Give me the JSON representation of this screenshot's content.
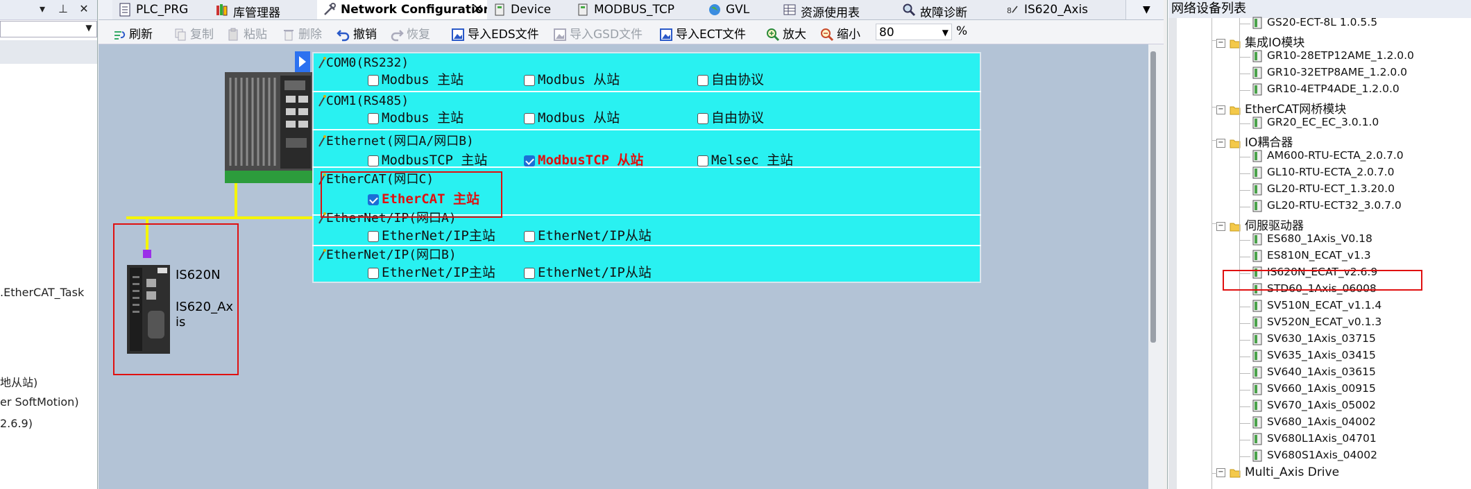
{
  "left_pane": {
    "items": [
      ".EtherCAT_Task",
      "地从站)",
      "er SoftMotion)",
      "2.6.9)"
    ]
  },
  "tabs": [
    {
      "label": "PLC_PRG",
      "icon": "document-icon"
    },
    {
      "label": "库管理器",
      "icon": "library-icon"
    },
    {
      "label": "Network Configuration",
      "icon": "network-config-icon",
      "active": true
    },
    {
      "label": "Device",
      "icon": "device-icon"
    },
    {
      "label": "MODBUS_TCP",
      "icon": "device-icon"
    },
    {
      "label": "GVL",
      "icon": "globe-icon"
    },
    {
      "label": "资源使用表",
      "icon": "table-icon"
    },
    {
      "label": "故障诊断",
      "icon": "magnifier-icon"
    },
    {
      "label": "IS620_Axis",
      "icon": "axis-icon"
    }
  ],
  "toolbar": {
    "refresh": "刷新",
    "copy": "复制",
    "paste": "粘贴",
    "delete": "删除",
    "undo": "撤销",
    "redo": "恢复",
    "import_eds": "导入EDS文件",
    "import_gsd": "导入GSD文件",
    "import_ect": "导入ECT文件",
    "zoom_in": "放大",
    "zoom_out": "缩小",
    "zoom_value": "80",
    "zoom_unit": "%"
  },
  "protocols": [
    {
      "port": "COM0(RS232)",
      "options": [
        {
          "label": "Modbus 主站",
          "checked": false
        },
        {
          "label": "Modbus 从站",
          "checked": false
        },
        {
          "label": "自由协议",
          "checked": false
        }
      ]
    },
    {
      "port": "COM1(RS485)",
      "options": [
        {
          "label": "Modbus 主站",
          "checked": false
        },
        {
          "label": "Modbus 从站",
          "checked": false
        },
        {
          "label": "自由协议",
          "checked": false
        }
      ]
    },
    {
      "port": "Ethernet(网口A/网口B)",
      "options": [
        {
          "label": "ModbusTCP 主站",
          "checked": false
        },
        {
          "label": "ModbusTCP 从站",
          "checked": true
        },
        {
          "label": "Melsec 主站",
          "checked": false
        }
      ]
    },
    {
      "port": "EtherCAT(网口C)",
      "options": [
        {
          "label": "EtherCAT 主站",
          "checked": true
        }
      ]
    },
    {
      "port": "EtherNet/IP(网口A)",
      "options": [
        {
          "label": "EtherNet/IP主站",
          "checked": false
        },
        {
          "label": "EtherNet/IP从站",
          "checked": false
        }
      ]
    },
    {
      "port": "EtherNet/IP(网口B)",
      "options": [
        {
          "label": "EtherNet/IP主站",
          "checked": false
        },
        {
          "label": "EtherNet/IP从站",
          "checked": false
        }
      ]
    }
  ],
  "slave_device": {
    "model": "IS620N",
    "name": "IS620_Axis"
  },
  "device_list": {
    "title": "网络设备列表",
    "tree": [
      {
        "label": "GS20-ECT-8L 1.0.5.5",
        "type": "device"
      },
      {
        "label": "集成IO模块",
        "type": "folder"
      },
      {
        "label": "GR10-28ETP12AME_1.2.0.0",
        "type": "device"
      },
      {
        "label": "GR10-32ETP8AME_1.2.0.0",
        "type": "device"
      },
      {
        "label": "GR10-4ETP4ADE_1.2.0.0",
        "type": "device"
      },
      {
        "label": "EtherCAT网桥模块",
        "type": "folder"
      },
      {
        "label": "GR20_EC_EC_3.0.1.0",
        "type": "device"
      },
      {
        "label": "IO耦合器",
        "type": "folder"
      },
      {
        "label": "AM600-RTU-ECTA_2.0.7.0",
        "type": "device"
      },
      {
        "label": "GL10-RTU-ECTA_2.0.7.0",
        "type": "device"
      },
      {
        "label": "GL20-RTU-ECT_1.3.20.0",
        "type": "device"
      },
      {
        "label": "GL20-RTU-ECT32_3.0.7.0",
        "type": "device"
      },
      {
        "label": "伺服驱动器",
        "type": "folder"
      },
      {
        "label": "ES680_1Axis_V0.18",
        "type": "device"
      },
      {
        "label": "ES810N_ECAT_v1.3",
        "type": "device"
      },
      {
        "label": "IS620N_ECAT_v2.6.9",
        "type": "device"
      },
      {
        "label": "STD60_1Axis_06008",
        "type": "device"
      },
      {
        "label": "SV510N_ECAT_v1.1.4",
        "type": "device"
      },
      {
        "label": "SV520N_ECAT_v0.1.3",
        "type": "device"
      },
      {
        "label": "SV630_1Axis_03715",
        "type": "device"
      },
      {
        "label": "SV635_1Axis_03415",
        "type": "device"
      },
      {
        "label": "SV640_1Axis_03615",
        "type": "device"
      },
      {
        "label": "SV660_1Axis_00915",
        "type": "device"
      },
      {
        "label": "SV670_1Axis_05002",
        "type": "device"
      },
      {
        "label": "SV680_1Axis_04002",
        "type": "device"
      },
      {
        "label": "SV680L1Axis_04701",
        "type": "device"
      },
      {
        "label": "SV680S1Axis_04002",
        "type": "device"
      },
      {
        "label": "Multi_Axis Drive",
        "type": "folder"
      }
    ]
  },
  "colors": {
    "panel_bg": "#29f1f1",
    "canvas_bg": "#b3c3d6",
    "highlight": "#e01010",
    "bus_line": "#f5f500",
    "connector": "#9b30e8"
  }
}
